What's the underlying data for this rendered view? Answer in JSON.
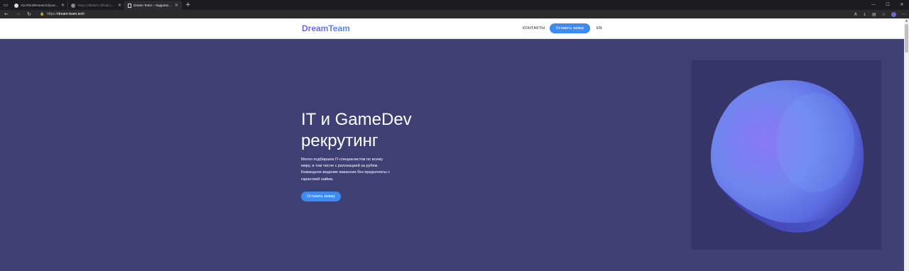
{
  "browser": {
    "tabs": [
      {
        "title": "YouThinkResearch/youthink-Acc...",
        "icon": "github-icon",
        "active": false,
        "dim": false
      },
      {
        "title": "Vicky Githtub's official consent...",
        "icon": "github-icon",
        "active": false,
        "dim": true
      },
      {
        "title": "Dream Team – Кадровое агент...",
        "icon": "document-icon",
        "active": true,
        "dim": false
      }
    ],
    "new_tab_glyph": "+",
    "window_controls": {
      "minimize": "—",
      "maximize": "☐",
      "close": "✕"
    },
    "url_prefix": "https://",
    "url_host": "dream-team.tech",
    "nav_glyphs": {
      "back": "←",
      "forward": "→",
      "reload": "↻"
    },
    "tool_glyphs": {
      "read": "A",
      "downloads": "↓",
      "extensions": "▤",
      "collections": "☆",
      "menu": "⋯"
    }
  },
  "site": {
    "logo": "DreamTeam",
    "nav_contacts": "КОНТАКТЫ",
    "cta_header": "Оставить заявку",
    "lang": "EN"
  },
  "hero": {
    "title_line1": "IT и GameDev",
    "title_line2": "рекрутинг",
    "desc_line1": "Метко подбираем IT-специалистов по всему",
    "desc_line2": "миру, в том числе с релокацией за рубеж.",
    "desc_line3": "Командное ведение вакансии без предоплаты с",
    "desc_line4": "гарантией найма.",
    "cta": "Оставить заявку"
  },
  "colors": {
    "hero_bg": "#3e3f73",
    "accent": "#3d8bf2",
    "logo_from": "#7a5ee6",
    "logo_to": "#4f8fe8"
  }
}
